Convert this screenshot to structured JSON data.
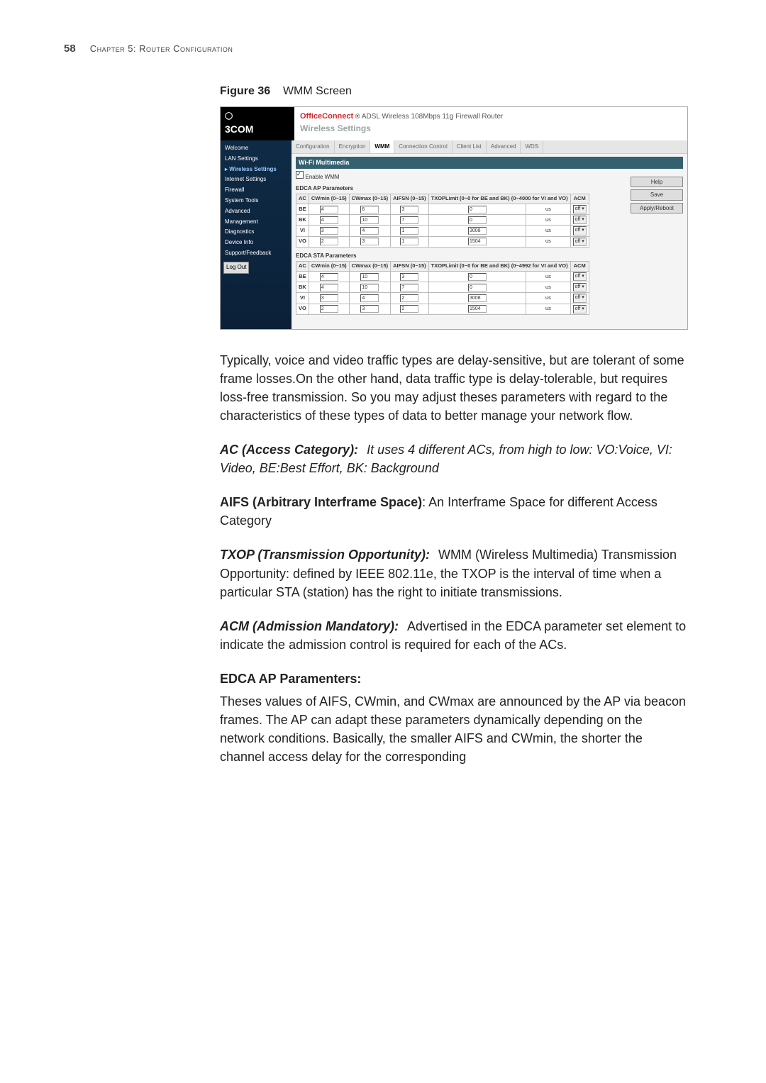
{
  "page": {
    "number": "58",
    "chapter": "Chapter 5: Router Configuration"
  },
  "figure": {
    "label": "Figure 36",
    "title": "WMM Screen"
  },
  "screenshot": {
    "logo": "3COM",
    "brand_oc": "OfficeConnect",
    "brand_rest": "ADSL Wireless 108Mbps 11g Firewall Router",
    "brand_sub": "Wireless Settings",
    "tabs": [
      "Configuration",
      "Encryption",
      "WMM",
      "Connection Control",
      "Client List",
      "Advanced",
      "WDS"
    ],
    "active_tab": "WMM",
    "side_items": [
      "Welcome",
      "LAN Settings",
      "Wireless Settings",
      "Internet Settings",
      "Firewall",
      "System Tools",
      "Advanced",
      "Management",
      "Diagnostics",
      "Device Info",
      "Support/Feedback"
    ],
    "side_highlight": "Wireless Settings",
    "logout": "Log Out",
    "right_buttons": [
      "Help",
      "Save",
      "Apply/Reboot"
    ],
    "panel_title": "Wi-Fi Multimedia",
    "enable_label": "Enable WMM",
    "ap_title": "EDCA AP Parameters",
    "sta_title": "EDCA STA Parameters",
    "ap_head": [
      "AC",
      "CWmin (0~15)",
      "CWmax (0~15)",
      "AIFSN (0~15)",
      "TXOPLimit (0~0 for BE and BK) (0~4000 for VI and VO)",
      "ACM"
    ],
    "sta_head": [
      "AC",
      "CWmin (0~15)",
      "CWmax (0~15)",
      "AIFSN (0~15)",
      "TXOPLimit (0~0 for BE and BK) (0~4992 for VI and VO)",
      "ACM"
    ],
    "ap_rows": [
      {
        "ac": "BE",
        "cwmin": "4",
        "cwmax": "6",
        "aifsn": "3",
        "txop": "0",
        "unit": "us",
        "acm": "off"
      },
      {
        "ac": "BK",
        "cwmin": "4",
        "cwmax": "10",
        "aifsn": "7",
        "txop": "0",
        "unit": "us",
        "acm": "off"
      },
      {
        "ac": "VI",
        "cwmin": "3",
        "cwmax": "4",
        "aifsn": "1",
        "txop": "3008",
        "unit": "us",
        "acm": "off"
      },
      {
        "ac": "VO",
        "cwmin": "2",
        "cwmax": "3",
        "aifsn": "1",
        "txop": "1504",
        "unit": "us",
        "acm": "off"
      }
    ],
    "sta_rows": [
      {
        "ac": "BE",
        "cwmin": "4",
        "cwmax": "10",
        "aifsn": "3",
        "txop": "0",
        "unit": "us",
        "acm": "off"
      },
      {
        "ac": "BK",
        "cwmin": "4",
        "cwmax": "10",
        "aifsn": "7",
        "txop": "0",
        "unit": "us",
        "acm": "off"
      },
      {
        "ac": "VI",
        "cwmin": "3",
        "cwmax": "4",
        "aifsn": "2",
        "txop": "3008",
        "unit": "us",
        "acm": "off"
      },
      {
        "ac": "VO",
        "cwmin": "2",
        "cwmax": "3",
        "aifsn": "2",
        "txop": "1504",
        "unit": "us",
        "acm": "off"
      }
    ]
  },
  "para1": "Typically, voice and video traffic types are delay-sensitive, but are tolerant of some frame losses.On the other hand, data traffic type is delay-tolerable, but requires loss-free transmission. So you may adjust theses parameters with regard to the characteristics of these types of data to better manage your network flow.",
  "defs": {
    "ac_lbl": "AC (Access Category):",
    "ac_txt": "It uses 4 different ACs, from high to low: VO:Voice, VI: Video, BE:Best Effort, BK: Background",
    "aifs_lbl": "AIFS (Arbitrary Interframe Space)",
    "aifs_txt": ": An Interframe Space for different Access Category",
    "txop_lbl": "TXOP (Transmission Opportunity):",
    "txop_txt": "WMM (Wireless Multimedia) Transmission Opportunity: defined by IEEE 802.11e, the TXOP is the interval of time when a particular STA (station) has the right to initiate transmissions.",
    "acm_lbl": "ACM (Admission Mandatory):",
    "acm_txt": "Advertised in the EDCA parameter set element to indicate the admission control is required for each of the ACs."
  },
  "edca_head": "EDCA AP Paramenters:",
  "para2": "Theses values of AIFS, CWmin, and CWmax are announced by the AP via beacon frames. The AP can adapt these parameters dynamically depending on the network conditions. Basically, the smaller AIFS and CWmin, the shorter the channel access delay for the corresponding"
}
